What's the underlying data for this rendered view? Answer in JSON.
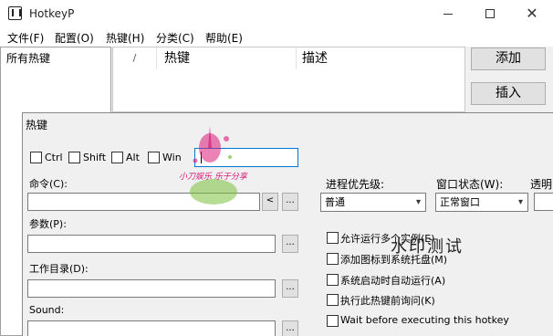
{
  "window": {
    "title": "HotkeyP",
    "minimize": "—",
    "maximize": "□",
    "close": "✕"
  },
  "menu": [
    "文件(F)",
    "配置(O)",
    "热键(H)",
    "分类(C)",
    "帮助(E)"
  ],
  "categories": {
    "items": [
      "所有热键"
    ]
  },
  "list": {
    "columns": [
      "/",
      "热键",
      "描述"
    ]
  },
  "buttons": {
    "add": "添加",
    "insert": "插入"
  },
  "dialog": {
    "title": "热键",
    "modifiers": [
      "Ctrl",
      "Shift",
      "Alt",
      "Win"
    ],
    "command_label": "命令(C):",
    "params_label": "参数(P):",
    "workdir_label": "工作目录(D):",
    "sound_label": "Sound:",
    "browse": "...",
    "back": "<",
    "priority_label": "进程优先级:",
    "priority_value": "普通",
    "window_state_label": "窗口状态(W):",
    "window_state_value": "正常窗口",
    "transparency_label": "透明",
    "options": [
      "允许运行多个实例(E)",
      "添加图标到系统托盘(M)",
      "系统启动时自动运行(A)",
      "执行此热键前询问(K)",
      "Wait before executing this hotkey"
    ]
  },
  "watermark": {
    "main": "水印测试",
    "sub": "小刀娱乐 乐于分享"
  },
  "colors": {
    "accent": "#0078d7",
    "watermark_pink": "#d81b7a"
  }
}
